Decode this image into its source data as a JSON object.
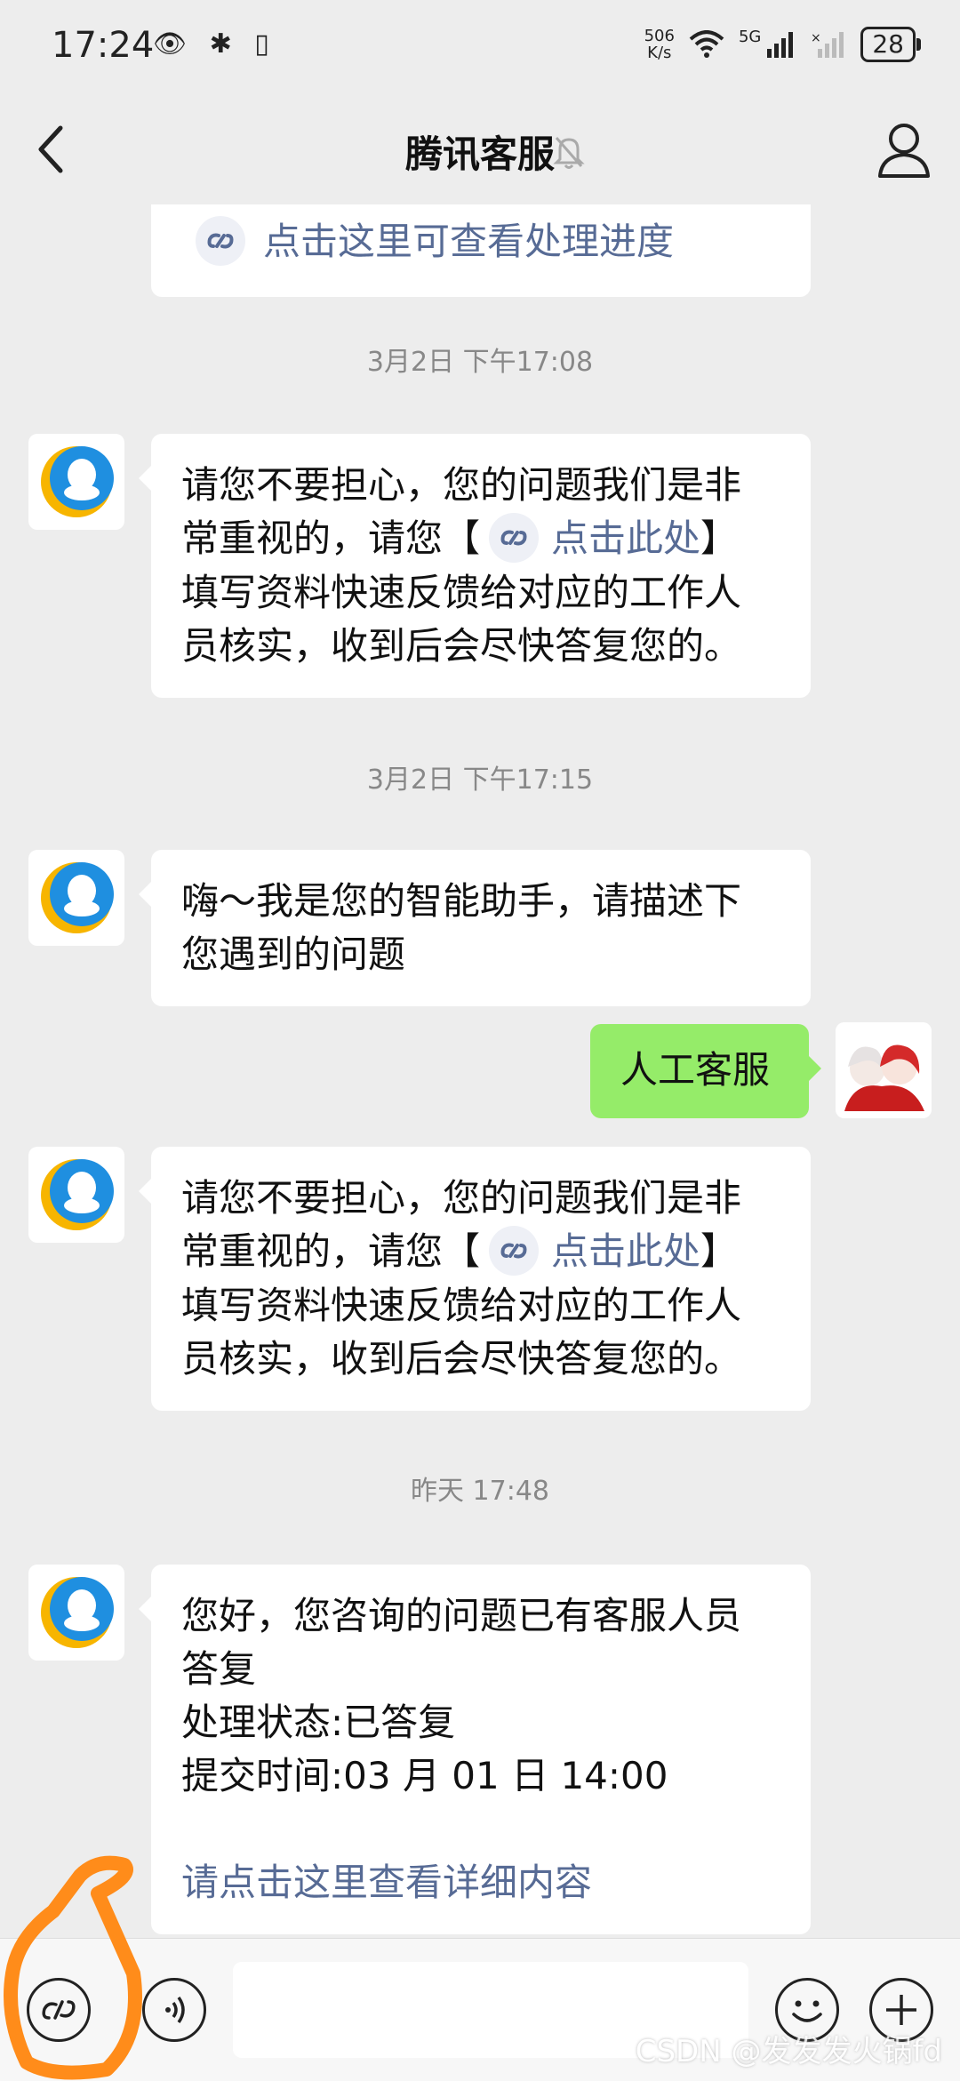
{
  "status": {
    "time": "17:24",
    "left_icons": "👁 ✱ ▯",
    "net_speed_value": "506",
    "net_speed_unit": "K/s",
    "net_type": "5G",
    "battery": "28"
  },
  "header": {
    "title": "腾讯客服"
  },
  "messages": {
    "top_link": "点击这里可查看处理进度",
    "ts1": "3月2日 下午17:08",
    "m1_line1": "请您不要担心，您的问题我们是非",
    "m1_line2_a": "常重视的，请您【",
    "m1_line2_link": "点击此处",
    "m1_line2_b": "】",
    "m1_line3": "填写资料快速反馈给对应的工作人",
    "m1_line4": "员核实，收到后会尽快答复您的。",
    "ts2": "3月2日 下午17:15",
    "m2_line1": "嗨～我是您的智能助手，请描述下",
    "m2_line2": "您遇到的问题",
    "user_msg": "人工客服",
    "m3_line1": "请您不要担心，您的问题我们是非",
    "m3_line2_a": "常重视的，请您【",
    "m3_line2_link": "点击此处",
    "m3_line2_b": "】",
    "m3_line3": "填写资料快速反馈给对应的工作人",
    "m3_line4": "员核实，收到后会尽快答复您的。",
    "ts3": "昨天 17:48",
    "m4_line1": "您好，您咨询的问题已有客服人员",
    "m4_line2": "答复",
    "m4_line3": "处理状态:已答复",
    "m4_line4": "提交时间:03 月 01 日 14:00",
    "m4_link": "请点击这里查看详细内容"
  },
  "watermark": "CSDN @发发发火锅fd",
  "colors": {
    "background": "#ededed",
    "user_bubble": "#95ec69",
    "link": "#576b95",
    "annotation": "#ff8c1a"
  }
}
